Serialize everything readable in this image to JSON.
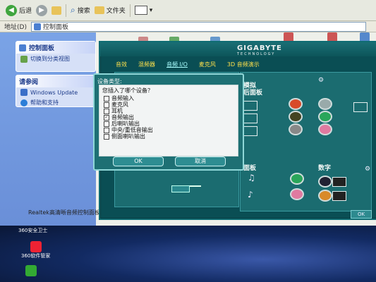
{
  "explorer": {
    "toolbar": {
      "back": "后退",
      "search": "搜索",
      "folders": "文件夹"
    },
    "address": {
      "label": "地址(D)",
      "value": "控制面板"
    },
    "sidebar": {
      "control_panel": {
        "title": "控制面板",
        "switch": "切换到分类视图"
      },
      "see_also": {
        "title": "请参阅",
        "items": [
          "Windows Update",
          "帮助和支持"
        ]
      }
    },
    "status": "Realtek高清晰音频控制面板"
  },
  "gigabyte": {
    "logo": "GIGABYTE",
    "logo_sub": "TECHNOLOGY",
    "tabs": [
      "音效",
      "混频器",
      "音频 I/O",
      "麦克风",
      "3D 音频演示"
    ],
    "active_tab": 2,
    "back_panel_label": "模拟\n后面板",
    "front_panel_label": "面板",
    "digital_label": "数字",
    "ok_label": "OK"
  },
  "dialog": {
    "title": "设备类型:",
    "question": "您插入了哪个设备？",
    "options": [
      {
        "label": "音频输入",
        "checked": false
      },
      {
        "label": "麦克风",
        "checked": false
      },
      {
        "label": "耳机",
        "checked": false
      },
      {
        "label": "音频输出",
        "checked": true
      },
      {
        "label": "后喇叭输出",
        "checked": false
      },
      {
        "label": "中央/重低音输出",
        "checked": false
      },
      {
        "label": "侧面喇叭输出",
        "checked": false
      }
    ],
    "ok": "OK",
    "cancel": "取消"
  },
  "desktop": {
    "icons": [
      "360安全卫士",
      "360软件管家"
    ]
  }
}
